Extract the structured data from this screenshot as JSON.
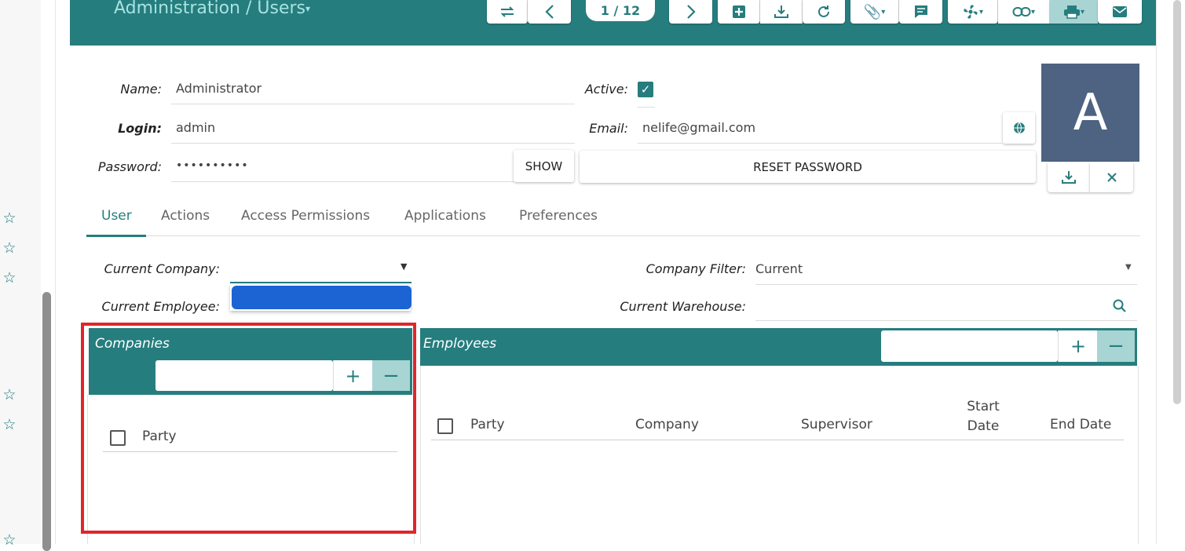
{
  "header": {
    "title": "Administration / Users",
    "title_caret": "▾",
    "counter": "1 / 12",
    "accent": "#267d7e",
    "toolbar_icons": [
      "switch-icon",
      "prev-icon",
      "next-icon",
      "new-icon",
      "save-icon",
      "reload-icon",
      "attachment-icon",
      "note-icon",
      "action-icon",
      "relate-icon",
      "print-icon",
      "email-icon"
    ]
  },
  "form": {
    "name_label": "Name:",
    "name_value": "Administrator",
    "login_label": "Login:",
    "login_value": "admin",
    "password_label": "Password:",
    "password_value": "••••••••••",
    "show_button": "SHOW",
    "active_label": "Active:",
    "active_checked": true,
    "email_label": "Email:",
    "email_value": "nelife@gmail.com",
    "reset_password_button": "RESET PASSWORD",
    "avatar_letter": "A",
    "avatar_color": "#4e6381"
  },
  "tabs": [
    {
      "label": "User",
      "active": true
    },
    {
      "label": "Actions"
    },
    {
      "label": "Access Permissions"
    },
    {
      "label": "Applications"
    },
    {
      "label": "Preferences"
    }
  ],
  "user_tab": {
    "current_company_label": "Current Company:",
    "current_company_value": "",
    "current_employee_label": "Current Employee:",
    "company_filter_label": "Company Filter:",
    "company_filter_value": "Current",
    "current_warehouse_label": "Current Warehouse:",
    "current_warehouse_value": ""
  },
  "companies": {
    "title": "Companies",
    "columns": [
      "Party"
    ]
  },
  "employees": {
    "title": "Employees",
    "columns": [
      "Party",
      "Company",
      "Supervisor",
      "Start Date",
      "End Date"
    ]
  }
}
